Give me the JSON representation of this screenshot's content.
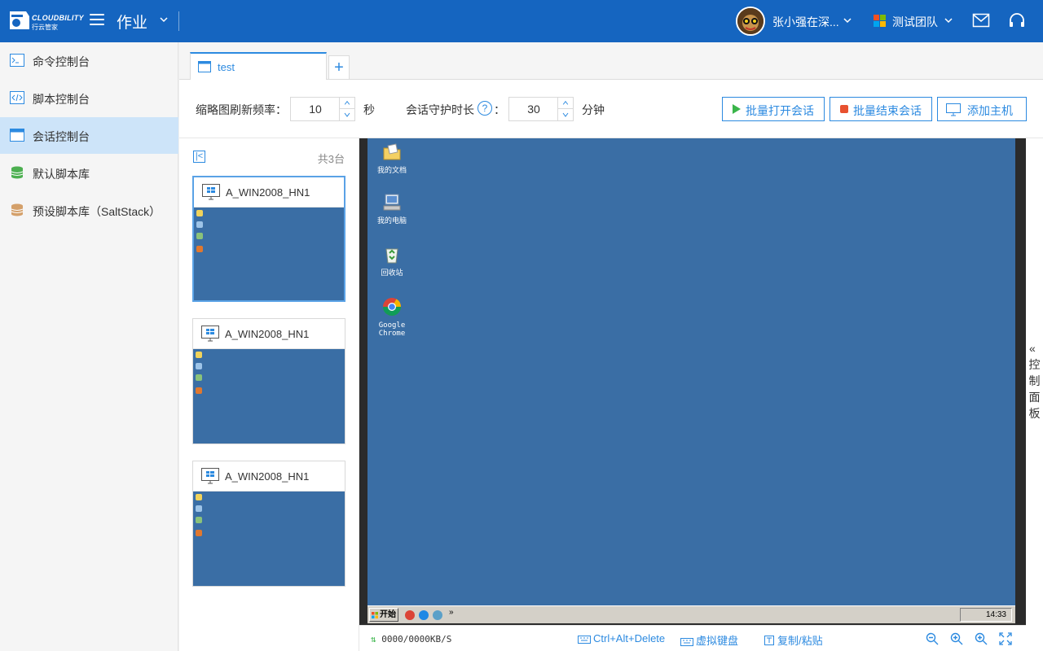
{
  "header": {
    "brand": "CLOUDBILITY",
    "brand_sub": "行云管家",
    "title": "作业",
    "user_name": "张小强在深...",
    "team_name": "测试团队",
    "colors": {
      "bar": "#1565c0",
      "accent": "#2c8ae0"
    }
  },
  "sidebar": {
    "items": [
      {
        "label": "命令控制台",
        "icon": "terminal-icon"
      },
      {
        "label": "脚本控制台",
        "icon": "code-icon"
      },
      {
        "label": "会话控制台",
        "icon": "window-icon",
        "active": true
      },
      {
        "label": "默认脚本库",
        "icon": "database-green-icon"
      },
      {
        "label": "预设脚本库（SaltStack）",
        "icon": "database-orange-icon"
      }
    ]
  },
  "tabs": [
    {
      "label": "test",
      "active": true
    }
  ],
  "toolbar": {
    "refresh_label": "缩略图刷新频率：",
    "refresh_value": "10",
    "refresh_unit": "秒",
    "keepalive_label": "会话守护时长",
    "keepalive_colon": "：",
    "keepalive_value": "30",
    "keepalive_unit": "分钟",
    "open_sessions": "批量打开会话",
    "end_sessions": "批量结束会话",
    "add_host": "添加主机"
  },
  "hosts": {
    "count_label": "共3台",
    "items": [
      {
        "name": "A_WIN2008_HN1",
        "selected": true
      },
      {
        "name": "A_WIN2008_HN1",
        "selected": false
      },
      {
        "name": "A_WIN2008_HN1",
        "selected": false
      }
    ]
  },
  "desktop": {
    "icons": [
      {
        "label": "我的文档"
      },
      {
        "label": "我的电脑"
      },
      {
        "label": "回收站"
      },
      {
        "label": "Google\nChrome"
      }
    ],
    "start_label": "开始",
    "clock": "14:33",
    "background": "#3a6ea5"
  },
  "control_panel_label": "控制面板",
  "status": {
    "speed": "0000/0000KB/S",
    "ctrl_alt_del": "Ctrl+Alt+Delete",
    "virtual_keyboard": "虚拟键盘",
    "copy_paste": "复制/粘贴"
  }
}
